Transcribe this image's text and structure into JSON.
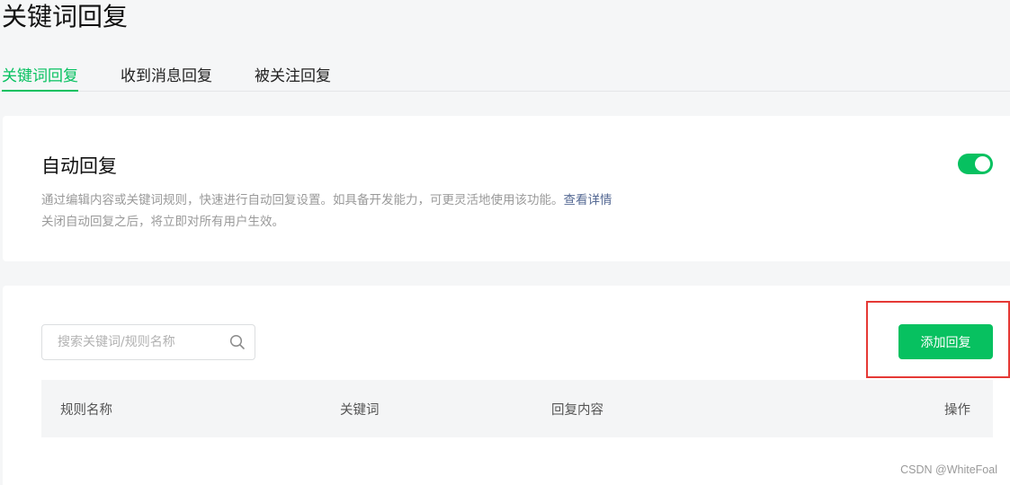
{
  "page": {
    "title": "关键词回复"
  },
  "tabs": [
    {
      "label": "关键词回复",
      "active": true
    },
    {
      "label": "收到消息回复",
      "active": false
    },
    {
      "label": "被关注回复",
      "active": false
    }
  ],
  "auto_reply": {
    "title": "自动回复",
    "desc_line1": "通过编辑内容或关键词规则，快速进行自动回复设置。如具备开发能力，可更灵活地使用该功能。",
    "desc_link": "查看详情",
    "desc_line2": "关闭自动回复之后，将立即对所有用户生效。",
    "enabled": true
  },
  "search": {
    "placeholder": "搜索关键词/规则名称",
    "value": ""
  },
  "toolbar": {
    "add_label": "添加回复"
  },
  "table": {
    "columns": [
      "规则名称",
      "关键词",
      "回复内容",
      "操作"
    ]
  },
  "watermark": "CSDN @WhiteFoal",
  "colors": {
    "accent": "#07c160",
    "link": "#576b95",
    "highlight": "#e53935"
  },
  "icons": {
    "search": "search-icon"
  }
}
